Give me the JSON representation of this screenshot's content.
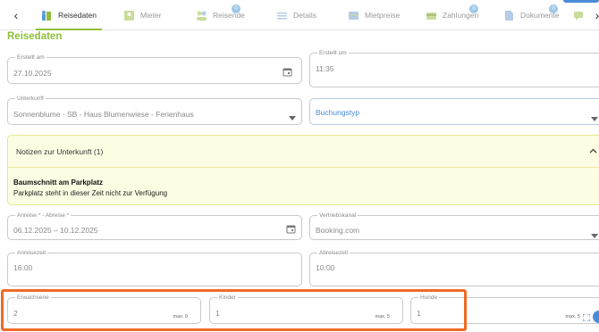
{
  "tabs": [
    {
      "label": "Reisedaten",
      "icon": "trip-icon",
      "active": true,
      "badge": ""
    },
    {
      "label": "Mieter",
      "icon": "tenant-icon",
      "active": false,
      "badge": ""
    },
    {
      "label": "Reisende",
      "icon": "travelers-icon",
      "active": false,
      "badge": "0"
    },
    {
      "label": "Details",
      "icon": "details-icon",
      "active": false,
      "badge": ""
    },
    {
      "label": "Mietpreise",
      "icon": "prices-icon",
      "active": false,
      "badge": ""
    },
    {
      "label": "Zahlungen",
      "icon": "payments-icon",
      "active": false,
      "badge": "0"
    },
    {
      "label": "Dokumente",
      "icon": "documents-icon",
      "active": false,
      "badge": "0"
    }
  ],
  "page_title": "Reisedaten",
  "fields": {
    "erstellt_am": {
      "label": "Erstellt am",
      "value": "27.10.2025"
    },
    "erstellt_um": {
      "label": "Erstellt um",
      "value": "11:35"
    },
    "unterkunft": {
      "label": "Unterkunft",
      "value": "Sonnenblume - SB - Haus Blumenwiese - Ferienhaus"
    },
    "buchungstyp": {
      "placeholder": "Buchungstyp"
    },
    "anreise_abreise": {
      "label": "Anreise * - Abreise *",
      "value": "06.12.2025 – 10.12.2025"
    },
    "vertriebskanal": {
      "label": "Vertriebskanal",
      "value": "Booking.com"
    },
    "anreisezeit": {
      "label": "Anreisezeit",
      "value": "16:00"
    },
    "abreisezeit": {
      "label": "Abreisezeit",
      "value": "10:00"
    },
    "erwachsene": {
      "label": "Erwachsene",
      "value": "2",
      "max": "max. 9"
    },
    "kinder": {
      "label": "Kinder",
      "value": "1",
      "max": "max. 5"
    },
    "hunde": {
      "label": "Hunde",
      "value": "1",
      "max": "max. 5"
    }
  },
  "notes": {
    "header": "Notizen zur Unterkunft (1)",
    "items": [
      {
        "title": "Baumschnitt am Parkplatz",
        "text": "Parkplatz steht in dieser Zeit nicht zur Verfügung"
      }
    ]
  },
  "colors": {
    "accent": "#8fbf3a",
    "highlight": "#ef6a25",
    "blue": "#4a8bd8"
  }
}
